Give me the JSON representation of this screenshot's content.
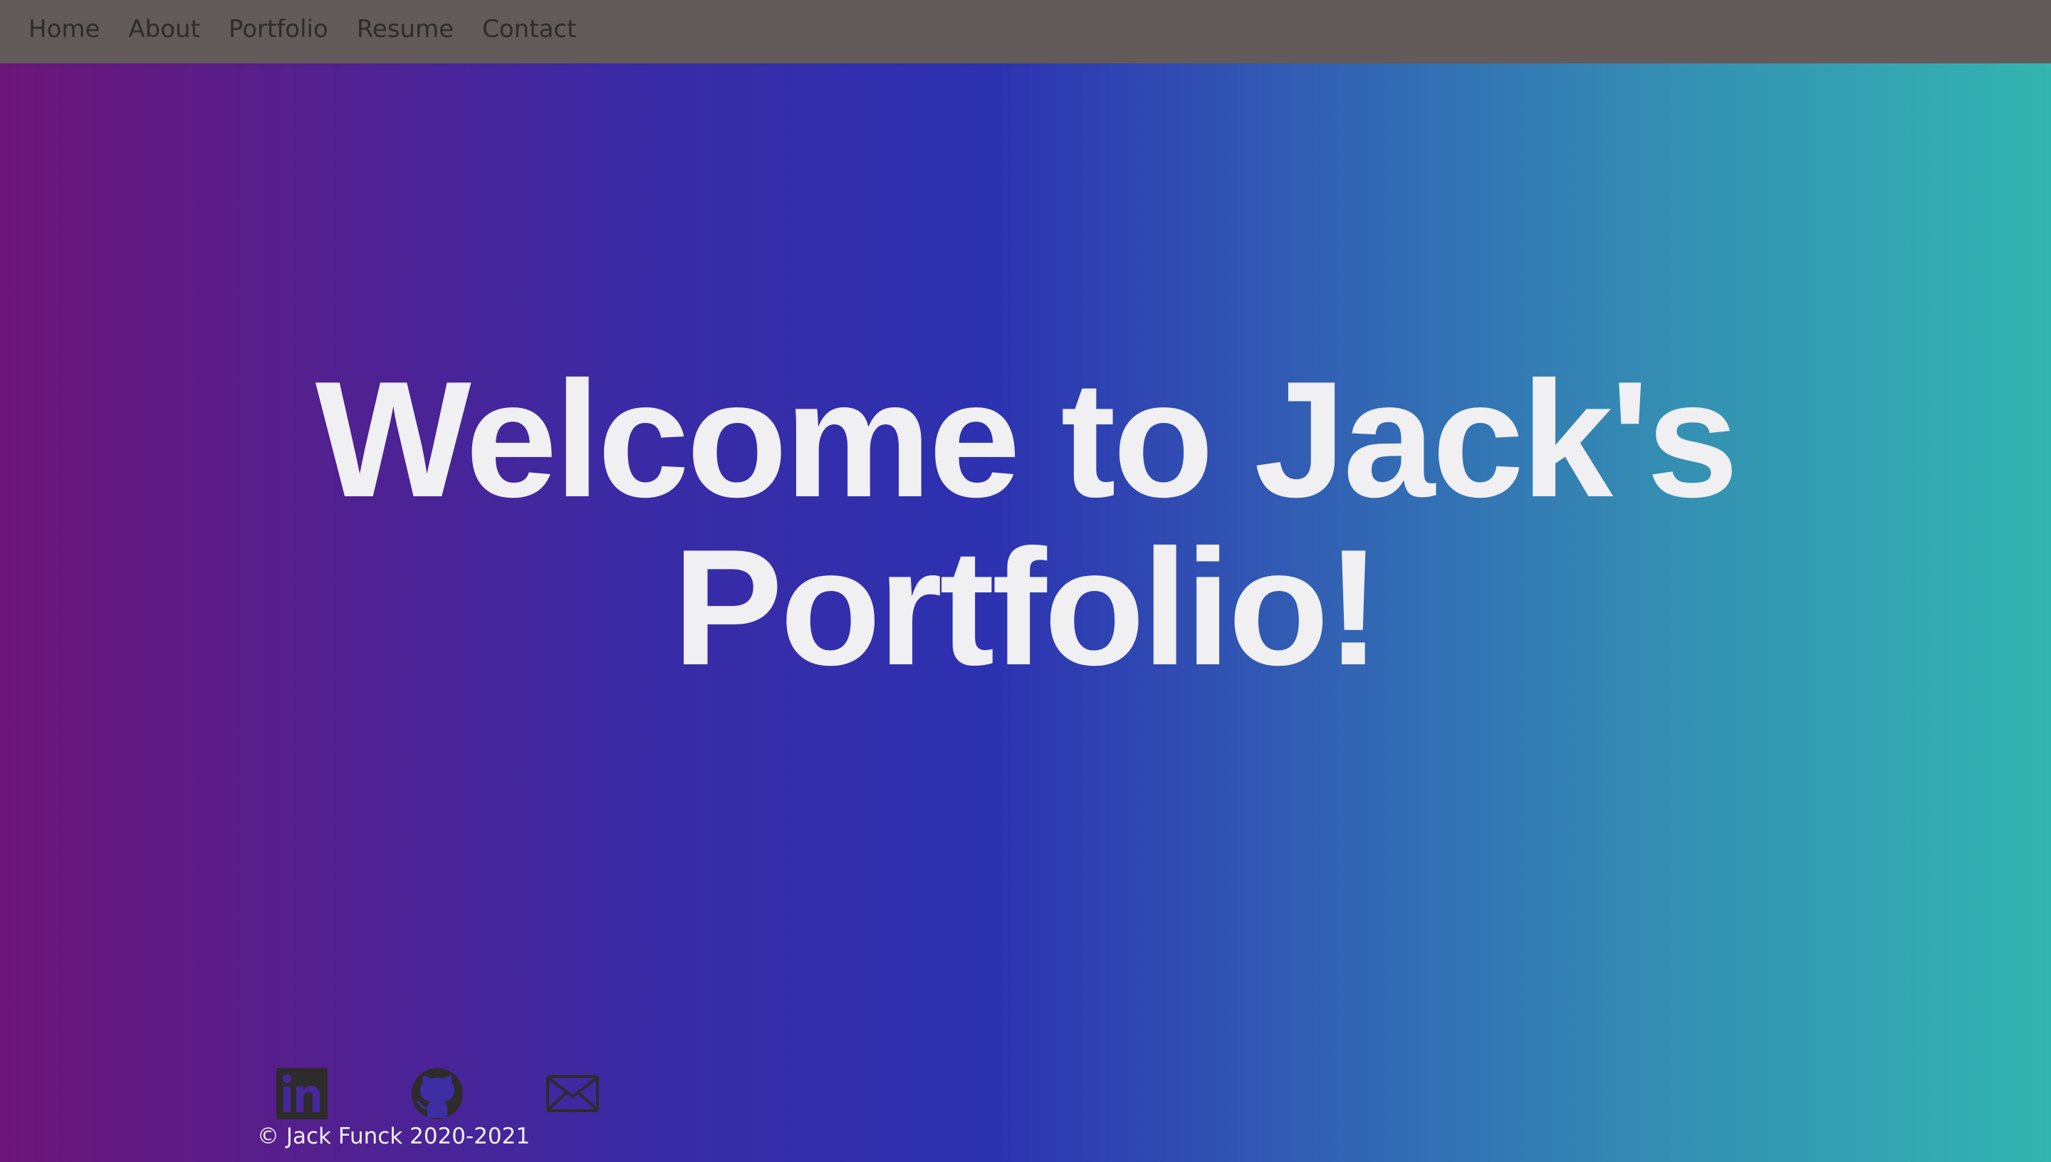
{
  "nav": {
    "items": [
      {
        "label": "Home"
      },
      {
        "label": "About"
      },
      {
        "label": "Portfolio"
      },
      {
        "label": "Resume"
      },
      {
        "label": "Contact"
      }
    ]
  },
  "hero": {
    "title": "Welcome to Jack's Portfolio!"
  },
  "footer": {
    "socials": [
      {
        "icon": "linkedin-icon"
      },
      {
        "icon": "github-icon"
      },
      {
        "icon": "mail-icon"
      }
    ],
    "copyright": "© Jack Funck 2020-2021"
  },
  "colors": {
    "navbar_bg": "#625b59",
    "nav_text": "#2e2b2b",
    "hero_text": "#f0eff2",
    "gradient_left": "#6c1578",
    "gradient_mid": "#2d31b0",
    "gradient_right": "#33b5b0",
    "icon_color": "#2e2b2b"
  }
}
